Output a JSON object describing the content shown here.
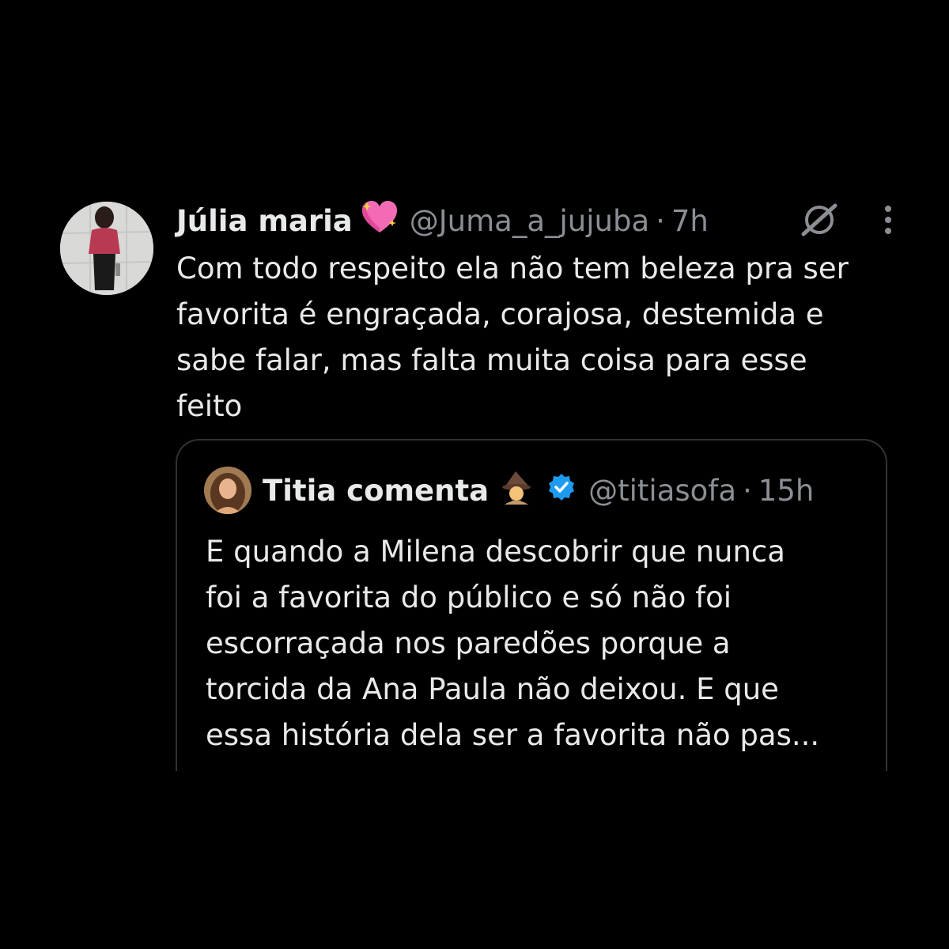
{
  "tweet": {
    "display_name": "Júlia maria",
    "name_emoji": "sparkling-heart-icon",
    "handle": "@Juma_a_jujuba",
    "separator": "·",
    "time": "7h",
    "text": "Com todo respeito ela não tem beleza pra ser\nfavorita é engraçada, corajosa, destemida e\nsabe falar, mas falta muita coisa para esse\nfeito"
  },
  "quoted_tweet": {
    "display_name": "Titia comenta",
    "name_emoji": "mage-icon",
    "verified_icon": "verified-badge-icon",
    "handle": "@titiasofa",
    "separator": "·",
    "time": "15h",
    "text": "E quando a Milena descobrir que nunca\nfoi a favorita do público e só não foi\nescorraçada nos paredões porque a\ntorcida da Ana Paula não deixou. E que\nessa história dela ser a favorita não pas..."
  },
  "colors": {
    "background": "#000000",
    "text_primary": "#e7e9ea",
    "text_secondary": "#8b8f94",
    "border": "#2f3336",
    "verified_blue": "#1d9bf0"
  }
}
